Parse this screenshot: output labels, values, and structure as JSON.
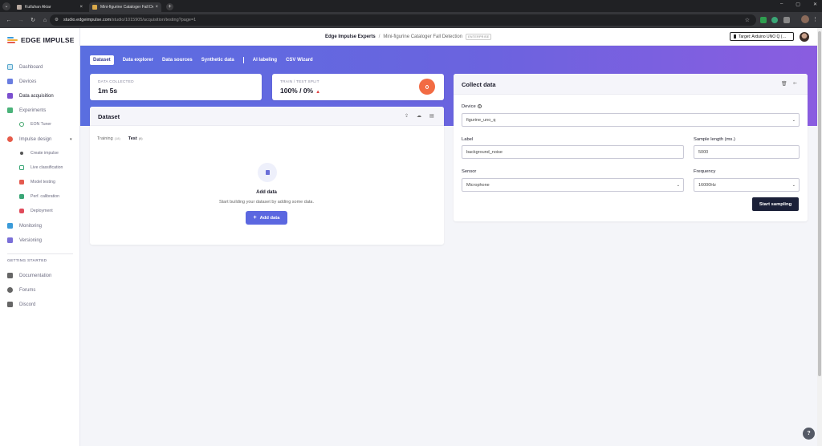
{
  "browser": {
    "tabs": [
      {
        "title": "Kutluhan Aktar",
        "active": false
      },
      {
        "title": "Mini-figurine Cataloger Fall De",
        "active": true
      }
    ],
    "url_host": "studio.edgeimpulse.com",
    "url_path": "/studio/1015905/acquisition/testing?page=1"
  },
  "app": {
    "logo_text": "EDGE IMPULSE",
    "project_owner": "Edge Impulse Experts",
    "separator": "/",
    "project_name": "Mini-figurine Cataloger Fall Detection",
    "plan_badge": "ENTERPRISE",
    "target_button": "Target: Arduino UNO Q (…"
  },
  "sidebar": {
    "items": [
      {
        "label": "Dashboard"
      },
      {
        "label": "Devices"
      },
      {
        "label": "Data acquisition"
      },
      {
        "label": "Experiments"
      },
      {
        "label": "EON Tuner"
      },
      {
        "label": "Impulse design"
      },
      {
        "label": "Create impulse"
      },
      {
        "label": "Live classification"
      },
      {
        "label": "Model testing"
      },
      {
        "label": "Perf. calibration"
      },
      {
        "label": "Deployment"
      },
      {
        "label": "Monitoring"
      },
      {
        "label": "Versioning"
      }
    ],
    "section_heading": "GETTING STARTED",
    "help_items": [
      {
        "label": "Documentation"
      },
      {
        "label": "Forums"
      },
      {
        "label": "Discord"
      }
    ]
  },
  "subnav": {
    "tabs": [
      "Dataset",
      "Data explorer",
      "Data sources",
      "Synthetic data",
      "AI labeling",
      "CSV Wizard"
    ]
  },
  "stats": {
    "collected_label": "DATA COLLECTED",
    "collected_value": "1m 5s",
    "split_label": "TRAIN / TEST SPLIT",
    "split_value": "100% / 0%"
  },
  "dataset": {
    "title": "Dataset",
    "tabs": [
      {
        "label": "Training",
        "count": "(18)"
      },
      {
        "label": "Test",
        "count": "(0)"
      }
    ],
    "empty_title": "Add data",
    "empty_subtitle": "Start building your dataset by adding some data.",
    "add_button": "Add data"
  },
  "collect": {
    "title": "Collect data",
    "device_label": "Device",
    "device_value": "figurine_uno_q",
    "label_label": "Label",
    "label_value": "background_noise",
    "sample_length_label": "Sample length (ms.)",
    "sample_length_value": "5000",
    "sensor_label": "Sensor",
    "sensor_value": "Microphone",
    "frequency_label": "Frequency",
    "frequency_value": "16000Hz",
    "start_button": "Start sampling"
  },
  "colors": {
    "accent": "#5b67e0",
    "banner_start": "#5a6ee0",
    "banner_end": "#8a5de0",
    "split_indicator": "#f26b43",
    "primary_dark": "#1b2038"
  }
}
